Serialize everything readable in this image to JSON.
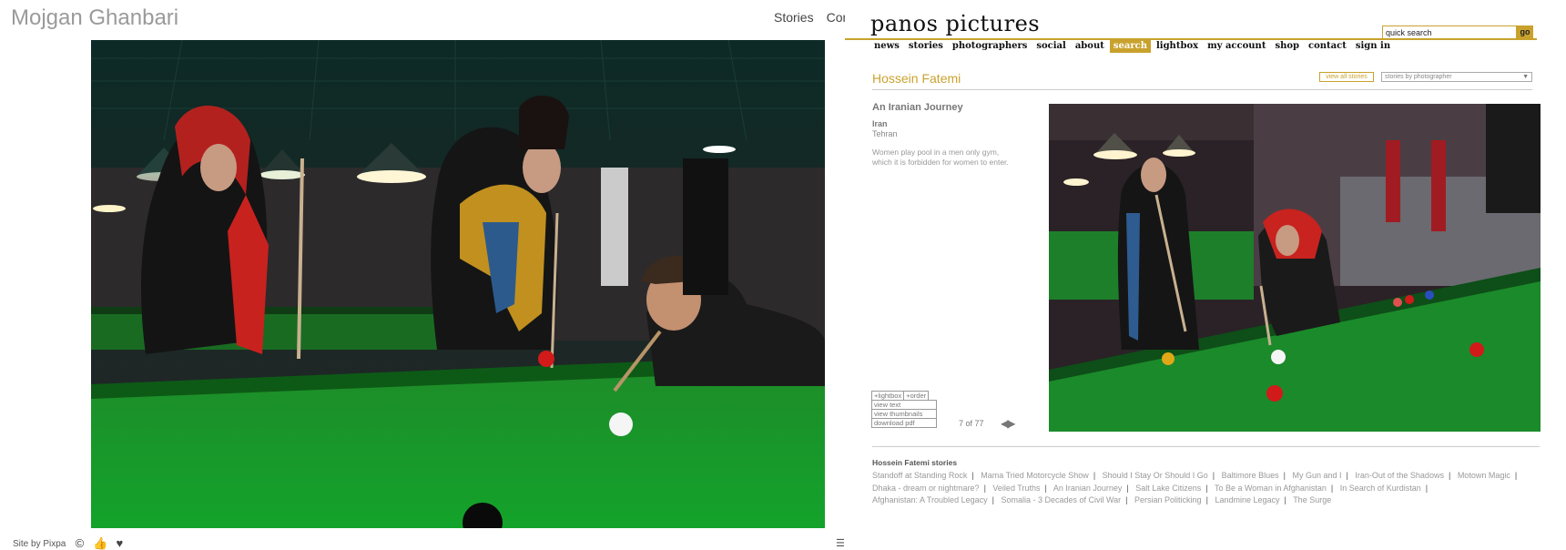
{
  "left": {
    "site_name": "Mojgan Ghanbari",
    "nav": [
      "Stories",
      "Con"
    ],
    "footer": {
      "credit": "Site by Pixpa"
    }
  },
  "right": {
    "logo": "panos pictures",
    "search": {
      "value": "quick search",
      "go_label": "go"
    },
    "topnav": [
      {
        "label": "news"
      },
      {
        "label": "stories"
      },
      {
        "label": "photographers"
      },
      {
        "label": "social"
      },
      {
        "label": "about"
      },
      {
        "label": "search",
        "active": true
      },
      {
        "label": "lightbox"
      },
      {
        "label": "my account"
      },
      {
        "label": "shop"
      },
      {
        "label": "contact"
      },
      {
        "label": "sign in"
      }
    ],
    "photographer": "Hossein Fatemi",
    "view_all_label": "view all stories",
    "select_label": "stories by photographer",
    "story": {
      "title": "An Iranian Journey",
      "country": "Iran",
      "city": "Tehran",
      "caption": "Women play pool in a men only gym, which it is forbidden for women to enter."
    },
    "tools": {
      "lightbox": "+lightbox",
      "order": "+order",
      "view_text": "view text",
      "view_thumbnails": "view thumbnails",
      "download_pdf": "download pdf"
    },
    "counter": "7 of 77",
    "stories_heading": "Hossein Fatemi stories",
    "stories": [
      "Standoff at Standing Rock",
      "Mama Tried Motorcycle Show",
      "Should I Stay Or Should I Go",
      "Baltimore Blues",
      "My Gun and I",
      "Iran-Out of the Shadows",
      "Motown Magic",
      "Dhaka - dream or nightmare?",
      "Veiled Truths",
      "An Iranian Journey",
      "Salt Lake Citizens",
      "To Be a Woman in Afghanistan",
      "In Search of Kurdistan",
      "Afghanistan: A Troubled Legacy",
      "Somalia - 3 Decades of Civil War",
      "Persian Politicking",
      "Landmine Legacy",
      "The Surge"
    ]
  },
  "colors": {
    "accent": "#c9a22d",
    "felt": "#1f8a2a"
  }
}
